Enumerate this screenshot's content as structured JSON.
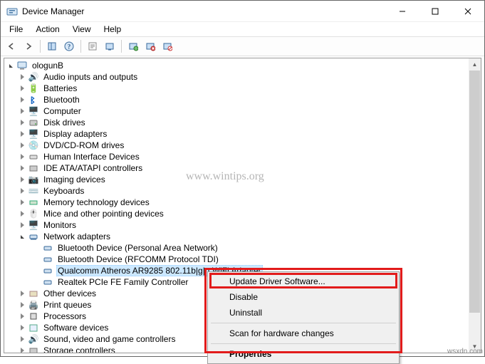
{
  "window": {
    "title": "Device Manager"
  },
  "menubar": {
    "file": "File",
    "action": "Action",
    "view": "View",
    "help": "Help"
  },
  "tree": {
    "root": "ologunB",
    "items": [
      "Audio inputs and outputs",
      "Batteries",
      "Bluetooth",
      "Computer",
      "Disk drives",
      "Display adapters",
      "DVD/CD-ROM drives",
      "Human Interface Devices",
      "IDE ATA/ATAPI controllers",
      "Imaging devices",
      "Keyboards",
      "Memory technology devices",
      "Mice and other pointing devices",
      "Monitors",
      "Network adapters",
      "Other devices",
      "Print queues",
      "Processors",
      "Software devices",
      "Sound, video and game controllers",
      "Storage controllers"
    ],
    "network_children": [
      "Bluetooth Device (Personal Area Network)",
      "Bluetooth Device (RFCOMM Protocol TDI)",
      "Qualcomm Atheros AR9285 802.11b|g|n WiFi Adapter",
      "Realtek PCIe FE Family Controller"
    ]
  },
  "context_menu": {
    "update": "Update Driver Software...",
    "disable": "Disable",
    "uninstall": "Uninstall",
    "scan": "Scan for hardware changes",
    "properties": "Properties"
  },
  "watermark": "www.wintips.org",
  "attribution": "wsxdn.com"
}
